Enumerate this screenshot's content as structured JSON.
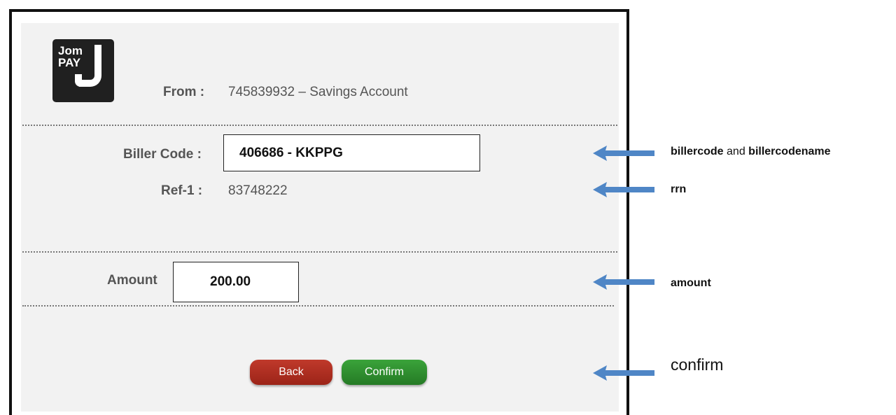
{
  "form": {
    "from_label": "From :",
    "from_value": "745839932 – Savings Account",
    "biller_label": "Biller Code :",
    "biller_value": "406686 - KKPPG",
    "ref_label": "Ref-1 :",
    "ref_value": "83748222",
    "amount_label": "Amount",
    "amount_value": "200.00",
    "back_label": "Back",
    "confirm_label": "Confirm"
  },
  "logo": {
    "line1": "Jom",
    "line2": "PAY"
  },
  "annotations": {
    "billercode": "billercode",
    "and_word": " and ",
    "billercodename": "billercodename",
    "rrn": "rrn",
    "amount": "amount",
    "confirm": "confirm"
  },
  "colors": {
    "back_button": "#b03226",
    "confirm_button": "#2f8f2f",
    "arrow": "#4f86c6",
    "panel_bg": "#f2f2f2"
  },
  "icons": {
    "annotation_arrow": "arrow-left-icon",
    "logo": "jompay-logo"
  }
}
